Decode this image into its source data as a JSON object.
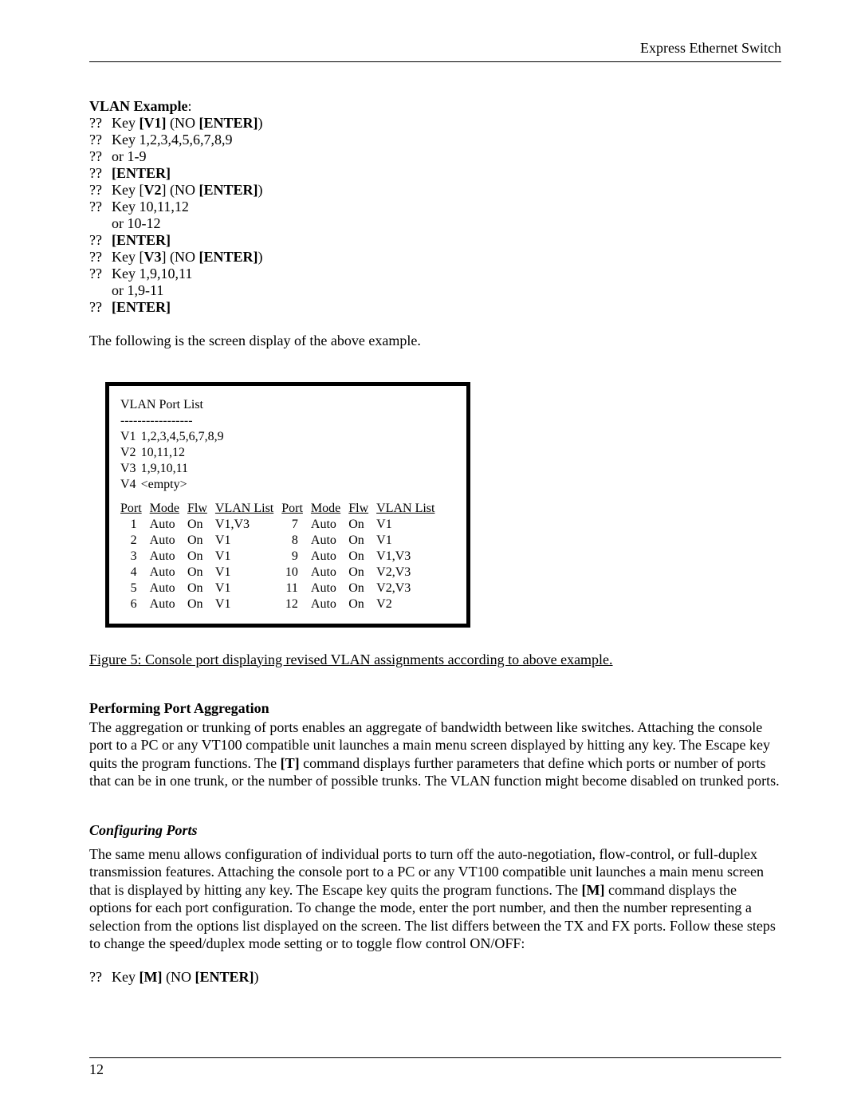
{
  "header": {
    "title": "Express Ethernet Switch"
  },
  "vlan_example": {
    "heading": "VLAN Example",
    "items": [
      {
        "marker": "??",
        "parts": [
          "Key ",
          {
            "b": "[V1]"
          },
          " (NO ",
          {
            "b": "[ENTER]"
          },
          ")"
        ]
      },
      {
        "marker": "??",
        "parts": [
          "Key 1,2,3,4,5,6,7,8,9"
        ]
      },
      {
        "marker": "??",
        "parts": [
          "or 1-9"
        ]
      },
      {
        "marker": "??",
        "parts": [
          {
            "b": "[ENTER]"
          }
        ]
      },
      {
        "marker": "??",
        "parts": [
          "Key [",
          {
            "b": "V2"
          },
          "] (NO ",
          {
            "b": "[ENTER]"
          },
          ")"
        ]
      },
      {
        "marker": "??",
        "parts": [
          "Key 10,11,12"
        ]
      },
      {
        "marker": "",
        "parts": [
          "or 10-12"
        ]
      },
      {
        "marker": "??",
        "parts": [
          {
            "b": "[ENTER]"
          }
        ]
      },
      {
        "marker": "??",
        "parts": [
          "Key [",
          {
            "b": "V3"
          },
          "] (NO ",
          {
            "b": "[ENTER]"
          },
          ")"
        ]
      },
      {
        "marker": "??",
        "parts": [
          "Key 1,9,10,11"
        ]
      },
      {
        "marker": "",
        "parts": [
          "or 1,9-11"
        ]
      },
      {
        "marker": "??",
        "parts": [
          {
            "b": "[ENTER]"
          }
        ]
      }
    ]
  },
  "intro_para": "The following is the screen display of the above example.",
  "console": {
    "header": "VLAN   Port List",
    "separator": "-----------------",
    "vlan_rows": [
      {
        "vlan": "V1",
        "ports": "1,2,3,4,5,6,7,8,9"
      },
      {
        "vlan": "V2",
        "ports": "10,11,12"
      },
      {
        "vlan": "V3",
        "ports": "1,9,10,11"
      },
      {
        "vlan": "V4",
        "ports": "<empty>"
      }
    ],
    "port_header": [
      "Port",
      "Mode",
      "Flw",
      "VLAN List",
      "Port",
      "Mode",
      "Flw",
      "VLAN List"
    ],
    "port_rows": [
      {
        "p1": "1",
        "m1": "Auto",
        "f1": "On",
        "v1": "V1,V3",
        "p2": "7",
        "m2": "Auto",
        "f2": "On",
        "v2": "V1"
      },
      {
        "p1": "2",
        "m1": "Auto",
        "f1": "On",
        "v1": "V1",
        "p2": "8",
        "m2": "Auto",
        "f2": "On",
        "v2": "V1"
      },
      {
        "p1": "3",
        "m1": "Auto",
        "f1": "On",
        "v1": "V1",
        "p2": "9",
        "m2": "Auto",
        "f2": "On",
        "v2": "V1,V3"
      },
      {
        "p1": "4",
        "m1": "Auto",
        "f1": "On",
        "v1": "V1",
        "p2": "10",
        "m2": "Auto",
        "f2": "On",
        "v2": "V2,V3"
      },
      {
        "p1": "5",
        "m1": "Auto",
        "f1": "On",
        "v1": "V1",
        "p2": "11",
        "m2": "Auto",
        "f2": "On",
        "v2": "V2,V3"
      },
      {
        "p1": "6",
        "m1": "Auto",
        "f1": "On",
        "v1": "V1",
        "p2": "12",
        "m2": "Auto",
        "f2": "On",
        "v2": "V2"
      }
    ]
  },
  "figure_caption": "Figure 5: Console port displaying revised VLAN assignments according to above example.",
  "port_agg": {
    "heading": "Performing Port Aggregation",
    "body_parts": [
      "The aggregation or trunking of ports enables an aggregate of bandwidth between like switches. Attaching the console port to a PC or any VT100 compatible unit launches a main menu screen displayed by hitting any key. The Escape key quits the program functions. The ",
      {
        "b": "[T]"
      },
      " command displays further parameters that define which ports or number of ports that can be in one trunk, or the number of possible trunks. The VLAN function might become disabled on trunked ports."
    ]
  },
  "config_ports": {
    "heading": "Configuring Ports",
    "body_parts": [
      "The same menu allows configuration of individual ports to turn off the auto-negotiation, flow-control, or full-duplex transmission features. Attaching the console port to a PC or any VT100 compatible unit launches a main menu screen that is displayed by hitting any key. The Escape key quits the program functions. The ",
      {
        "b": "[M]"
      },
      " command displays the options for each port configuration. To change the mode, enter the port number, and then the number representing a selection from the options list displayed on the screen. The list differs between the TX and FX ports. Follow these steps to change the speed/duplex mode setting or to toggle flow control ON/OFF:"
    ],
    "steps": [
      {
        "marker": "??",
        "parts": [
          "Key ",
          {
            "b": "[M]"
          },
          " (NO ",
          {
            "b": "[ENTER]"
          },
          ")"
        ]
      }
    ]
  },
  "footer": {
    "page_number": "12"
  }
}
